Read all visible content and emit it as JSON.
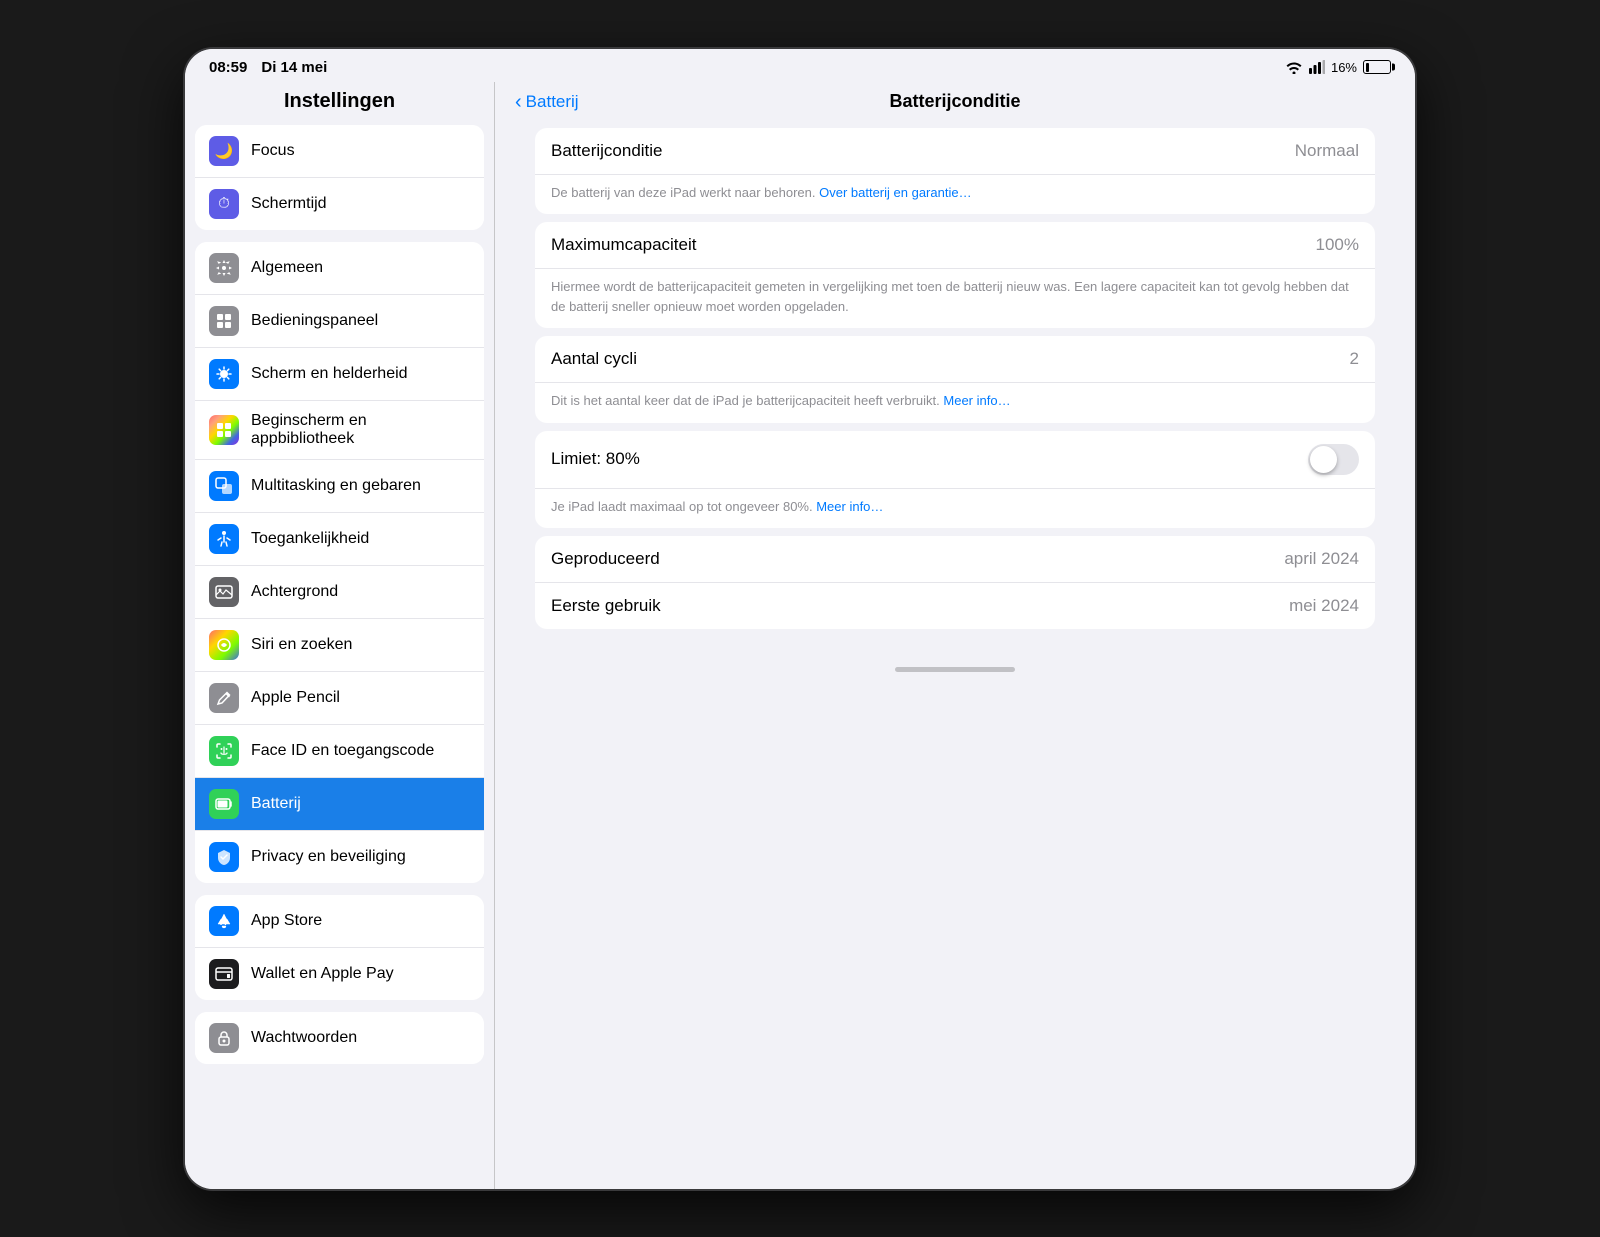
{
  "statusBar": {
    "time": "08:59",
    "date": "Di 14 mei",
    "battery": "16%",
    "wifiIcon": "wifi",
    "signalIcon": "signal"
  },
  "sidebar": {
    "title": "Instellingen",
    "groups": [
      {
        "id": "group1",
        "items": [
          {
            "id": "focus",
            "label": "Focus",
            "icon": "🌙",
            "iconBg": "ic-focus"
          },
          {
            "id": "schermtijd",
            "label": "Schermtijd",
            "icon": "⏱",
            "iconBg": "ic-screentime"
          }
        ]
      },
      {
        "id": "group2",
        "items": [
          {
            "id": "algemeen",
            "label": "Algemeen",
            "icon": "⚙",
            "iconBg": "ic-algemeen"
          },
          {
            "id": "bedieningspaneel",
            "label": "Bedieningspaneel",
            "icon": "▤",
            "iconBg": "ic-bedieningspaneel"
          },
          {
            "id": "scherm",
            "label": "Scherm en helderheid",
            "icon": "☀",
            "iconBg": "ic-scherm"
          },
          {
            "id": "beginscherm",
            "label": "Beginscherm en appbibliotheek",
            "icon": "⊞",
            "iconBg": "ic-beginscherm"
          },
          {
            "id": "multitasking",
            "label": "Multitasking en gebaren",
            "icon": "⊡",
            "iconBg": "ic-multitasking"
          },
          {
            "id": "toegankelijkheid",
            "label": "Toegankelijkheid",
            "icon": "♿",
            "iconBg": "ic-toegankelijkheid"
          },
          {
            "id": "achtergrond",
            "label": "Achtergrond",
            "icon": "🖼",
            "iconBg": "ic-achtergrond"
          },
          {
            "id": "siri",
            "label": "Siri en zoeken",
            "icon": "◉",
            "iconBg": "ic-siri"
          },
          {
            "id": "pencil",
            "label": "Apple Pencil",
            "icon": "✏",
            "iconBg": "ic-pencil"
          },
          {
            "id": "faceid",
            "label": "Face ID en toegangscode",
            "icon": "⬡",
            "iconBg": "ic-faceid"
          },
          {
            "id": "batterij",
            "label": "Batterij",
            "icon": "🔋",
            "iconBg": "ic-batterij",
            "active": true
          },
          {
            "id": "privacy",
            "label": "Privacy en beveiliging",
            "icon": "✋",
            "iconBg": "ic-privacy"
          }
        ]
      },
      {
        "id": "group3",
        "items": [
          {
            "id": "appstore",
            "label": "App Store",
            "icon": "A",
            "iconBg": "ic-appstore"
          },
          {
            "id": "wallet",
            "label": "Wallet en Apple Pay",
            "icon": "▣",
            "iconBg": "ic-wallet"
          }
        ]
      },
      {
        "id": "group4",
        "items": [
          {
            "id": "wachtwoorden",
            "label": "Wachtwoorden",
            "icon": "🔑",
            "iconBg": "ic-wachtwoorden"
          }
        ]
      }
    ]
  },
  "detail": {
    "backLabel": "Batterij",
    "title": "Batterijconditie",
    "cards": [
      {
        "id": "card-conditie",
        "rows": [
          {
            "id": "conditie-row",
            "label": "Batterijconditie",
            "value": "Normaal"
          }
        ],
        "description": "De batterij van deze iPad werkt naar behoren.",
        "descriptionLink": "Over batterij en garantie…",
        "descriptionAfterLink": ""
      },
      {
        "id": "card-capaciteit",
        "rows": [
          {
            "id": "capaciteit-row",
            "label": "Maximumcapaciteit",
            "value": "100%"
          }
        ],
        "description": "Hiermee wordt de batterijcapaciteit gemeten in vergelijking met toen de batterij nieuw was. Een lagere capaciteit kan tot gevolg hebben dat de batterij sneller opnieuw moet worden opgeladen."
      },
      {
        "id": "card-cycli",
        "rows": [
          {
            "id": "cycli-row",
            "label": "Aantal cycli",
            "value": "2"
          }
        ],
        "description": "Dit is het aantal keer dat de iPad je batterijcapaciteit heeft verbruikt.",
        "descriptionLink": "Meer info…"
      },
      {
        "id": "card-limiet",
        "rows": [
          {
            "id": "limiet-row",
            "label": "Limiet: 80%",
            "value": "",
            "hasToggle": true,
            "toggleOn": false
          }
        ],
        "description": "Je iPad laadt maximaal op tot ongeveer 80%.",
        "descriptionLink": "Meer info…"
      },
      {
        "id": "card-geproduceerd",
        "rows": [
          {
            "id": "geproduceerd-row",
            "label": "Geproduceerd",
            "value": "april 2024"
          },
          {
            "id": "eerste-gebruik-row",
            "label": "Eerste gebruik",
            "value": "mei 2024"
          }
        ]
      }
    ]
  }
}
